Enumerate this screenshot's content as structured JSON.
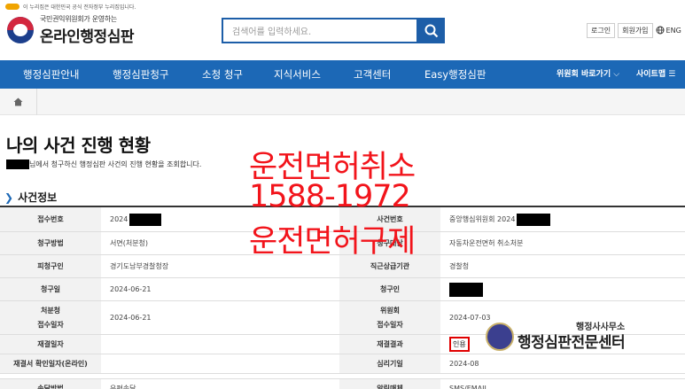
{
  "gov_strip": {
    "text": "이 누리집은 대한민국 공식 전자정부 누리집입니다."
  },
  "logo": {
    "subtitle": "국민권익위원회가 운영하는",
    "title": "온라인행정심판"
  },
  "search": {
    "placeholder": "검색어를 입력하세요."
  },
  "util": {
    "login": "로그인",
    "signup": "회원가입",
    "lang": "ENG"
  },
  "nav": {
    "items": [
      "행정심판안내",
      "행정심판청구",
      "소청 청구",
      "지식서비스",
      "고객센터",
      "Easy행정심판"
    ],
    "committee": "위원회 바로가기",
    "sitemap": "사이트맵"
  },
  "page": {
    "title": "나의 사건 진행 현황",
    "intro": "님에서 청구하신 행정심판 사건의 진행 현황을 조회합니다.",
    "section": "사건정보"
  },
  "table": {
    "receipt_no_label": "접수번호",
    "receipt_no": "2024",
    "case_no_label": "사건번호",
    "case_no": "중앙행심위원회 2024",
    "method_label": "청구방법",
    "method": "서면(처분청)",
    "subject_label": "청구대상",
    "subject": "자동차운전면허 취소처분",
    "respondent_label": "피청구인",
    "respondent": "경기도남부경찰청장",
    "superior_label": "직근상급기관",
    "superior": "경찰청",
    "claim_date_label": "청구일",
    "claim_date": "2024-06-21",
    "claimant_label": "청구인",
    "agency_receipt_label_1": "처분청",
    "agency_receipt_label_2": "접수일자",
    "agency_receipt": "2024-06-21",
    "committee_receipt_label_1": "위원회",
    "committee_receipt_label_2": "접수일자",
    "committee_receipt": "2024-07-03",
    "decision_date_label": "재결일자",
    "decision_date": "",
    "decision_result_label": "재결결과",
    "decision_result": "인용",
    "confirm_date_label": "재결서 확인일자(온라인)",
    "confirm_date": "",
    "hearing_date_label": "심리기일",
    "hearing_date": "2024-08",
    "delivery_label": "송달방법",
    "delivery": "우편송달",
    "notify_label": "알림매체",
    "notify": "SMS/EMAIL"
  },
  "overlay": {
    "line1": "운전면허취소",
    "line2": "1588-1972",
    "line3": "운전면허구제"
  },
  "watermark": {
    "sub": "행정사사무소",
    "main": "행정심판전문센터"
  },
  "colors": {
    "nav": "#1c68b6",
    "overlay": "#f2141b",
    "accent": "#1d5ea8"
  }
}
